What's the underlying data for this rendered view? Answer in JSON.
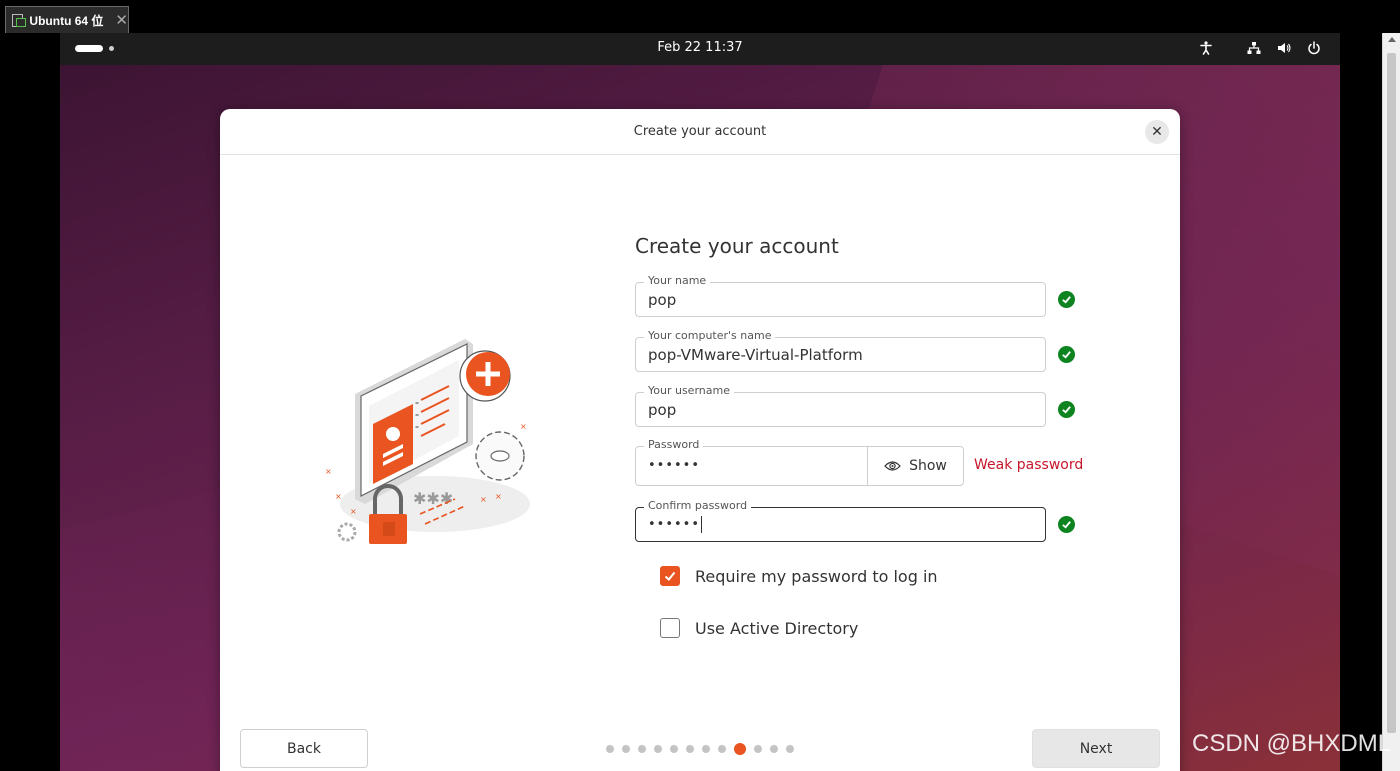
{
  "host": {
    "tab_title": "Ubuntu 64 位",
    "tab_close": "✕"
  },
  "topbar": {
    "clock": "Feb 22  11:37",
    "icons": [
      "accessibility-icon",
      "network-icon",
      "volume-icon",
      "power-icon"
    ]
  },
  "dialog": {
    "title": "Create your account",
    "close": "✕"
  },
  "form": {
    "heading": "Create your account",
    "name": {
      "label": "Your name",
      "value": "pop"
    },
    "computer": {
      "label": "Your computer's name",
      "value": "pop-VMware-Virtual-Platform"
    },
    "username": {
      "label": "Your username",
      "value": "pop"
    },
    "password": {
      "label": "Password",
      "value": "••••••",
      "show_label": "Show",
      "strength": "Weak password"
    },
    "confirm": {
      "label": "Confirm password",
      "value": "••••••"
    },
    "require_password": {
      "label": "Require my password to log in",
      "checked": true
    },
    "active_directory": {
      "label": "Use Active Directory",
      "checked": false
    }
  },
  "footer": {
    "back_label": "Back",
    "next_label": "Next",
    "pager": {
      "total": 12,
      "current": 9
    }
  },
  "watermark": "CSDN @BHXDML",
  "colors": {
    "accent": "#e95420",
    "success": "#0e8420",
    "error": "#c7162b"
  }
}
